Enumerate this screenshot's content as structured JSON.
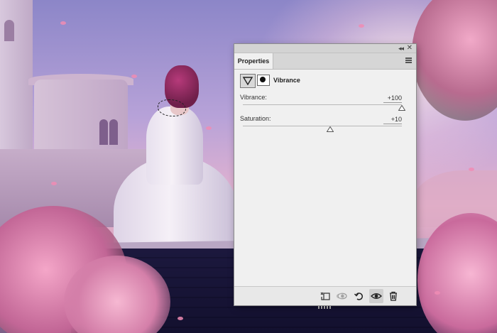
{
  "panel": {
    "tab_label": "Properties",
    "adjustment_name": "Vibrance",
    "adjustment_icon": "vibrance-triangle-icon",
    "mask_icon": "layer-mask-icon",
    "sliders": [
      {
        "label": "Vibrance:",
        "value": "+100",
        "position_fraction": 1.0
      },
      {
        "label": "Saturation:",
        "value": "+10",
        "position_fraction": 0.55
      }
    ],
    "bottom_buttons": [
      {
        "icon": "clip-to-layer-icon"
      },
      {
        "icon": "view-previous-state-icon"
      },
      {
        "icon": "reset-adjustment-icon"
      },
      {
        "icon": "toggle-visibility-eye-icon"
      },
      {
        "icon": "trash-icon"
      }
    ]
  },
  "colors": {
    "panel_bg": "#f0f0f0",
    "panel_header": "#d6d6d6",
    "sky_top": "#8c86c8",
    "blossom_pink": "#f4a6c8"
  }
}
